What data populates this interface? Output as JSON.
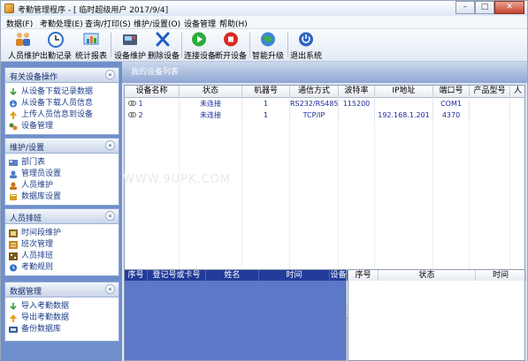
{
  "window": {
    "title": "考勤管理程序 - [ 临时超级用户 2017/9/4]",
    "min": "–",
    "max": "□",
    "close": "✕"
  },
  "menu": [
    "数据(F)",
    "考勤处理(E)",
    "查询/打印(S)",
    "维护/设置(O)",
    "设备管理",
    "帮助(H)"
  ],
  "toolbar": [
    {
      "label": "人员维护",
      "icon": "users-icon",
      "color": "#d9822b"
    },
    {
      "label": "出勤记录",
      "icon": "clock-icon",
      "color": "#2e6fc8"
    },
    {
      "label": "统计报表",
      "icon": "report-icon",
      "color": "#3b7ad6"
    },
    {
      "label": "设备维护",
      "icon": "device-icon",
      "color": "#4a5b78"
    },
    {
      "label": "删除设备",
      "icon": "delete-icon",
      "color": "#1f5fc4"
    },
    {
      "label": "连接设备",
      "icon": "play-icon",
      "color": "#2bab3a"
    },
    {
      "label": "断开设备",
      "icon": "stop-icon",
      "color": "#d72a22"
    },
    {
      "label": "智能升级",
      "icon": "globe-icon",
      "color": "#2f8f4a"
    },
    {
      "label": "退出系统",
      "icon": "power-icon",
      "color": "#2c63c3"
    }
  ],
  "sidebar": [
    {
      "title": "有关设备操作",
      "items": [
        {
          "label": "从设备下载记录数据",
          "icon": "download-icon",
          "color": "#3a9d3a"
        },
        {
          "label": "从设备下载人员信息",
          "icon": "download-user-icon",
          "color": "#3170c9"
        },
        {
          "label": "上传人员信息到设备",
          "icon": "upload-icon",
          "color": "#e0a020"
        },
        {
          "label": "设备管理",
          "icon": "device-manage-icon",
          "color": "#4f8a3c"
        }
      ]
    },
    {
      "title": "维护/设置",
      "items": [
        {
          "label": "部门表",
          "icon": "department-icon",
          "color": "#5c7fc2"
        },
        {
          "label": "管理员设置",
          "icon": "admin-icon",
          "color": "#4c7ac0"
        },
        {
          "label": "人员维护",
          "icon": "user-maintain-icon",
          "color": "#c7731f"
        },
        {
          "label": "数据库设置",
          "icon": "database-icon",
          "color": "#d4a11a"
        }
      ]
    },
    {
      "title": "人员排班",
      "items": [
        {
          "label": "时间段维护",
          "icon": "timeslot-icon",
          "color": "#8a6b22"
        },
        {
          "label": "班次管理",
          "icon": "shift-icon",
          "color": "#c78a1e"
        },
        {
          "label": "人员排班",
          "icon": "schedule-icon",
          "color": "#7a5a1c"
        },
        {
          "label": "考勤规则",
          "icon": "rule-icon",
          "color": "#2a6cc4"
        }
      ]
    },
    {
      "title": "数据管理",
      "items": [
        {
          "label": "导入考勤数据",
          "icon": "import-icon",
          "color": "#3a9d3a"
        },
        {
          "label": "导出考勤数据",
          "icon": "export-icon",
          "color": "#e0a020"
        },
        {
          "label": "备份数据库",
          "icon": "backup-icon",
          "color": "#3a5f9a"
        }
      ]
    }
  ],
  "chevron": "«",
  "content": {
    "tab_label": "我的设备列表",
    "columns": [
      "设备名称",
      "状态",
      "机器号",
      "通信方式",
      "波特率",
      "IP地址",
      "端口号",
      "产品型号",
      "人"
    ],
    "rows": [
      {
        "name": "1",
        "status": "未连接",
        "machine": "1",
        "comm": "RS232/RS485",
        "baud": "115200",
        "ip": "",
        "port": "COM1",
        "model": "",
        "extra": ""
      },
      {
        "name": "2",
        "status": "未连接",
        "machine": "1",
        "comm": "TCP/IP",
        "baud": "",
        "ip": "192.168.1.201",
        "port": "4370",
        "model": "",
        "extra": ""
      }
    ],
    "watermark": "WWW.9UPK.COM"
  },
  "bottom_left": {
    "columns": [
      "序号",
      "登记号或卡号",
      "姓名",
      "时间",
      "设备"
    ]
  },
  "bottom_right": {
    "columns": [
      "序号",
      "状态",
      "时间"
    ]
  }
}
